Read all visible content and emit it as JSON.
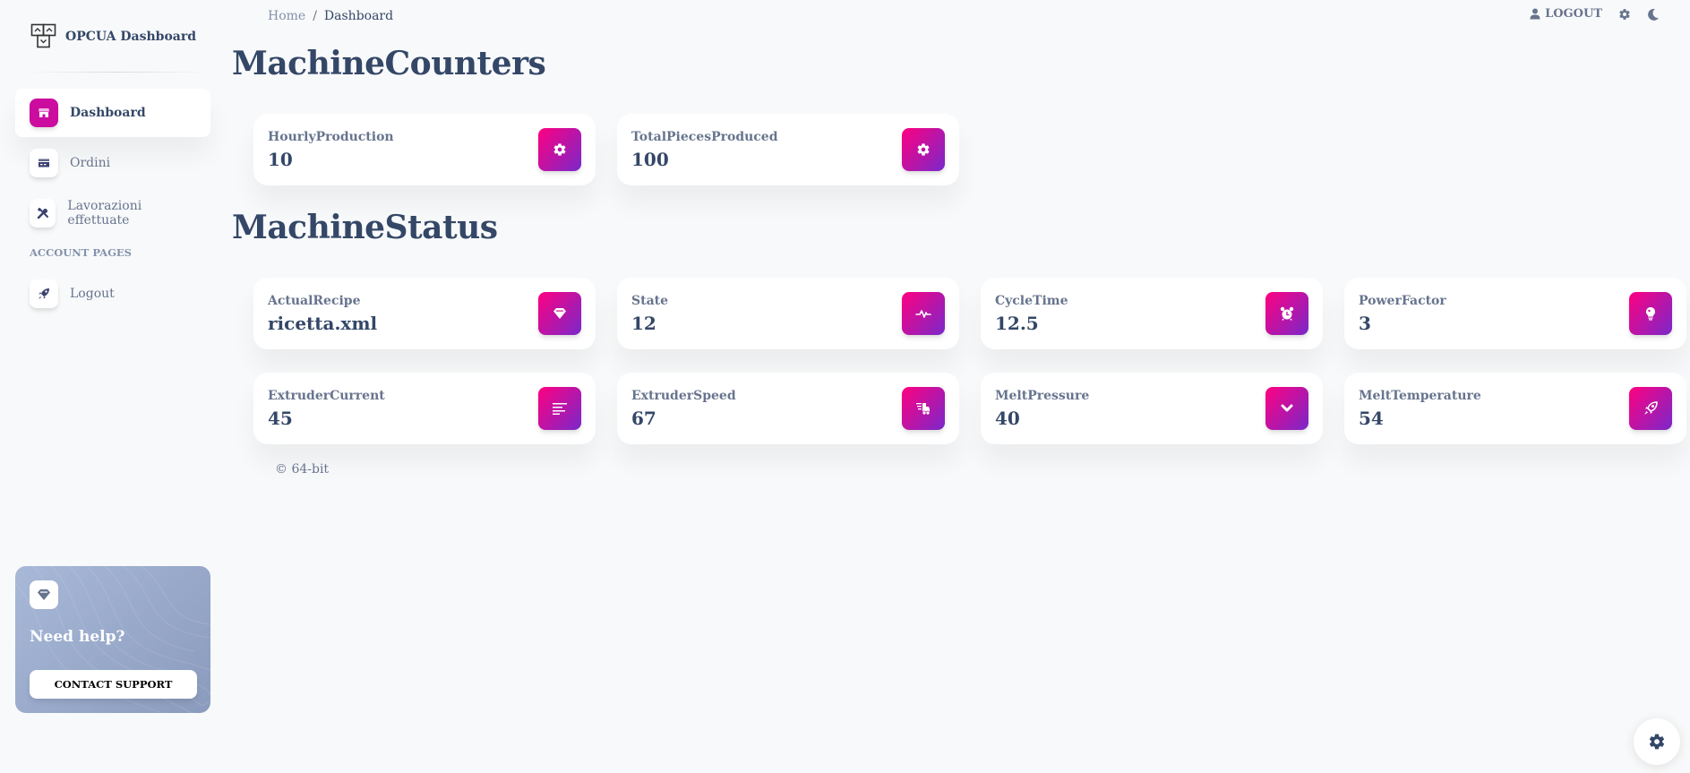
{
  "brand": {
    "name": "OPCUA Dashboard",
    "logo_icon": "opcua-logo-icon"
  },
  "sidebar": {
    "items": [
      {
        "label": "Dashboard",
        "icon": "shop-icon",
        "active": true
      },
      {
        "label": "Ordini",
        "icon": "credit-card-icon",
        "active": false
      },
      {
        "label": "Lavorazioni effettuate",
        "icon": "tools-icon",
        "active": false
      }
    ],
    "section_label": "ACCOUNT PAGES",
    "account_items": [
      {
        "label": "Logout",
        "icon": "rocket-icon"
      }
    ],
    "help": {
      "title": "Need help?",
      "button_label": "CONTACT SUPPORT",
      "icon": "diamond-icon"
    }
  },
  "breadcrumb": {
    "home": "Home",
    "separator": "/",
    "current": "Dashboard"
  },
  "topbar": {
    "logout_label": "LOGOUT",
    "icons": [
      "user-icon",
      "gear-icon",
      "moon-icon"
    ]
  },
  "sections": [
    {
      "title": "MachineCounters",
      "cards": [
        {
          "label": "HourlyProduction",
          "value": "10",
          "icon": "gear-icon"
        },
        {
          "label": "TotalPiecesProduced",
          "value": "100",
          "icon": "gear-icon"
        }
      ]
    },
    {
      "title": "MachineStatus",
      "cards": [
        {
          "label": "ActualRecipe",
          "value": "ricetta.xml",
          "icon": "diamond-icon"
        },
        {
          "label": "State",
          "value": "12",
          "icon": "heartbeat-icon"
        },
        {
          "label": "CycleTime",
          "value": "12.5",
          "icon": "alarm-clock-icon"
        },
        {
          "label": "PowerFactor",
          "value": "3",
          "icon": "lightbulb-icon"
        },
        {
          "label": "ExtruderCurrent",
          "value": "45",
          "icon": "align-left-icon"
        },
        {
          "label": "ExtruderSpeed",
          "value": "67",
          "icon": "shipping-fast-icon"
        },
        {
          "label": "MeltPressure",
          "value": "40",
          "icon": "chevron-down-icon"
        },
        {
          "label": "MeltTemperature",
          "value": "54",
          "icon": "rocket-icon"
        }
      ]
    }
  ],
  "footer": {
    "text": "© 64-bit"
  },
  "colors": {
    "accent_start": "#ff0080",
    "accent_end": "#7928ca",
    "active_nav": "#cb0c9f",
    "text_dark": "#344767",
    "text_muted": "#67748e"
  }
}
